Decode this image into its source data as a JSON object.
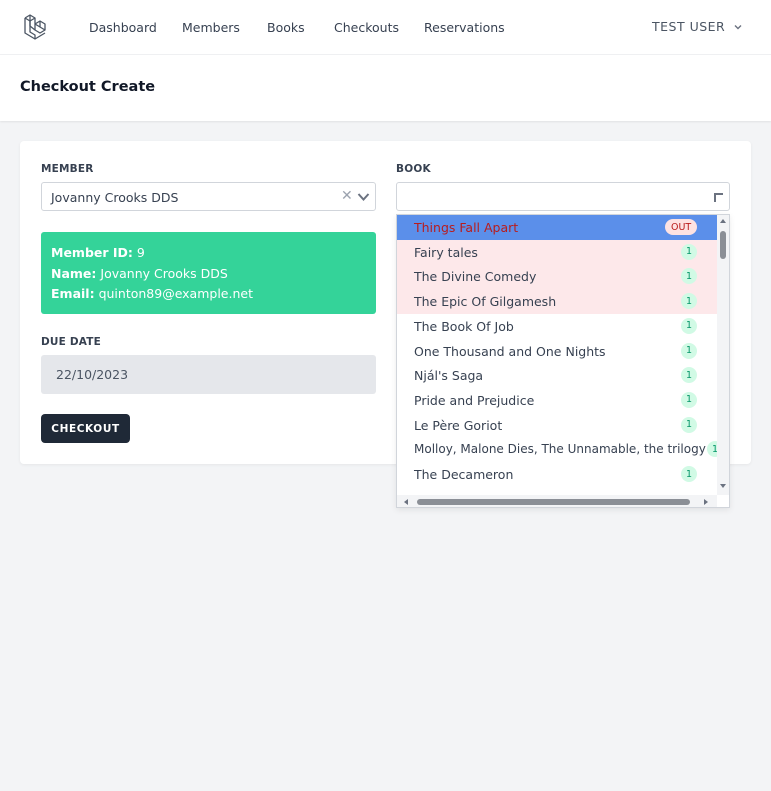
{
  "nav": {
    "links": [
      "Dashboard",
      "Members",
      "Books",
      "Checkouts",
      "Reservations"
    ],
    "user": "TEST USER"
  },
  "header": {
    "title": "Checkout Create"
  },
  "form": {
    "member_label": "MEMBER",
    "member_value": "Jovanny Crooks DDS",
    "member_info": {
      "id_label": "Member ID:",
      "id_value": "9",
      "name_label": "Name:",
      "name_value": "Jovanny Crooks DDS",
      "email_label": "Email:",
      "email_value": "quinton89@example.net"
    },
    "due_date_label": "DUE DATE",
    "due_date_value": "22/10/2023",
    "checkout_button": "CHECKOUT",
    "book_label": "BOOK",
    "book_value": ""
  },
  "book_options": [
    {
      "title": "Things Fall Apart",
      "badge": "OUT"
    },
    {
      "title": "Fairy tales",
      "badge": "1"
    },
    {
      "title": "The Divine Comedy",
      "badge": "1"
    },
    {
      "title": "The Epic Of Gilgamesh",
      "badge": "1"
    },
    {
      "title": "The Book Of Job",
      "badge": "1"
    },
    {
      "title": "One Thousand and One Nights",
      "badge": "1"
    },
    {
      "title": "Njál's Saga",
      "badge": "1"
    },
    {
      "title": "Pride and Prejudice",
      "badge": "1"
    },
    {
      "title": "Le Père Goriot",
      "badge": "1"
    },
    {
      "title": "Molloy, Malone Dies, The Unnamable, the trilogy",
      "badge": "1"
    },
    {
      "title": "The Decameron",
      "badge": "1"
    }
  ],
  "colors": {
    "member_info_bg": "#34d399",
    "highlight_bg": "#5b8fea",
    "button_bg": "#1f2937",
    "badge_green_bg": "#d1fae5",
    "badge_out_bg": "#fde2e2"
  }
}
